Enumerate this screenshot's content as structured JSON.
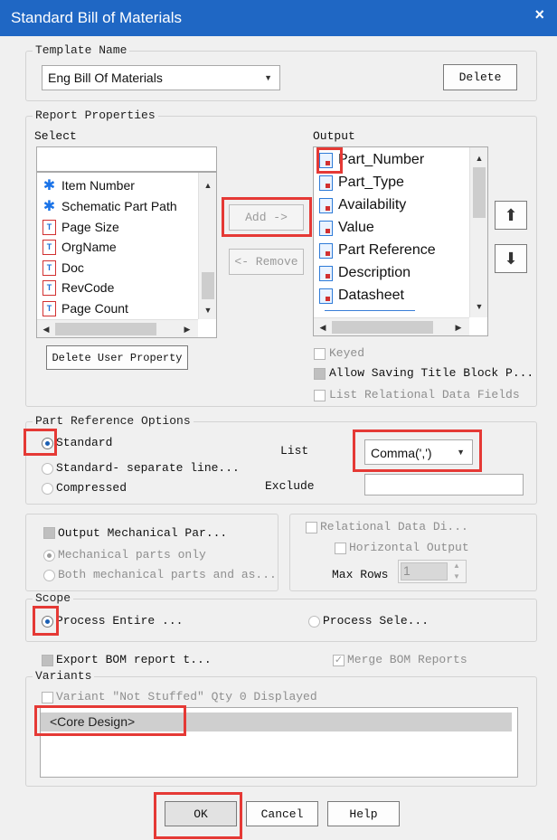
{
  "window": {
    "title": "Standard Bill of Materials",
    "close": "×"
  },
  "template": {
    "legend": "Template Name",
    "value": "Eng Bill Of Materials",
    "delete_label": "Delete"
  },
  "report": {
    "legend": "Report Properties",
    "select_label": "Select",
    "output_label": "Output",
    "select_items": [
      {
        "label": "Item Number",
        "icon": "asterisk-icon"
      },
      {
        "label": "Schematic Part Path",
        "icon": "asterisk-icon"
      },
      {
        "label": "Page Size",
        "icon": "text-property-icon"
      },
      {
        "label": "OrgName",
        "icon": "text-property-icon"
      },
      {
        "label": "Doc",
        "icon": "text-property-icon"
      },
      {
        "label": "RevCode",
        "icon": "text-property-icon"
      },
      {
        "label": "Page Count",
        "icon": "text-property-icon"
      }
    ],
    "output_items": [
      {
        "label": "Part_Number",
        "icon": "part-property-icon"
      },
      {
        "label": "Part_Type",
        "icon": "part-property-icon"
      },
      {
        "label": "Availability",
        "icon": "part-property-icon"
      },
      {
        "label": "Value",
        "icon": "part-property-icon"
      },
      {
        "label": "Part Reference",
        "icon": "part-property-icon"
      },
      {
        "label": "Description",
        "icon": "part-property-icon"
      },
      {
        "label": "Datasheet",
        "icon": "part-property-icon"
      }
    ],
    "add_label": "Add ->",
    "remove_label": "<- Remove",
    "delete_user_property_label": "Delete User Property",
    "keyed_label": "Keyed",
    "allow_saving_label": "Allow Saving Title Block P...",
    "list_relational_label": "List Relational Data Fields"
  },
  "part_ref": {
    "legend": "Part Reference Options",
    "standard_label": "Standard",
    "standard_separate_label": "Standard- separate line...",
    "compressed_label": "Compressed",
    "list_label": "List",
    "list_value": "Comma(',')",
    "exclude_label": "Exclude",
    "exclude_value": ""
  },
  "mechanical": {
    "output_mech_label": "Output Mechanical Par...",
    "mech_only_label": "Mechanical parts only",
    "both_label": "Both mechanical parts and as..."
  },
  "relational": {
    "relational_label": "Relational Data Di...",
    "horizontal_label": "Horizontal Output",
    "max_rows_label": "Max Rows",
    "max_rows_value": "1"
  },
  "scope": {
    "legend": "Scope",
    "process_entire_label": "Process Entire ...",
    "process_selection_label": "Process Sele..."
  },
  "export_label": "Export BOM report t...",
  "merge_label": "Merge BOM Reports",
  "variants": {
    "legend": "Variants",
    "not_stuffed_label": "Variant \"Not Stuffed\" Qty 0 Displayed",
    "selected": "<Core Design>"
  },
  "buttons": {
    "ok": "OK",
    "cancel": "Cancel",
    "help": "Help"
  }
}
